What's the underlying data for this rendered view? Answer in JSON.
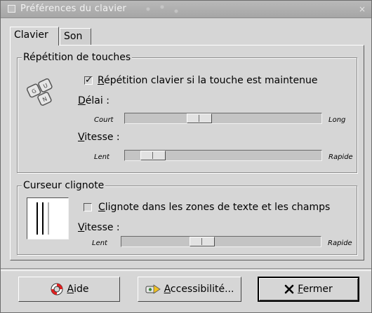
{
  "window": {
    "title": "Préférences du clavier",
    "close_glyph": "×"
  },
  "tabs": [
    {
      "label": "Clavier",
      "active": true
    },
    {
      "label": "Son",
      "active": false
    }
  ],
  "repeat_section": {
    "title": "Répétition de touches",
    "icon": "keyboard-icon",
    "checkbox": {
      "mnemonic": "R",
      "label_rest": "épétition clavier si la touche est maintenue",
      "checked": true,
      "check_glyph": "✓"
    },
    "delay": {
      "mnemonic": "D",
      "label_rest": "élai :",
      "min_label": "Court",
      "max_label": "Long",
      "value_fraction": 0.36
    },
    "speed": {
      "mnemonic": "V",
      "label_rest": "itesse :",
      "min_label": "Lent",
      "max_label": "Rapide",
      "value_fraction": 0.09
    }
  },
  "cursor_section": {
    "title": "Curseur clignote",
    "icon": "text-cursor-icon",
    "checkbox": {
      "mnemonic": "C",
      "label_rest": "lignote dans les zones de texte et les champs",
      "checked": false
    },
    "speed": {
      "mnemonic": "V",
      "label_rest": "itesse :",
      "min_label": "Lent",
      "max_label": "Rapide",
      "value_fraction": 0.39
    }
  },
  "buttons": {
    "help": {
      "mnemonic": "A",
      "rest": "ide",
      "icon": "lifebuoy-icon"
    },
    "accessibility": {
      "mnemonic": "A",
      "rest": "ccessibilité...",
      "icon": "accessibility-icon"
    },
    "close": {
      "mnemonic": "F",
      "rest": "ermer",
      "icon": "close-x-icon"
    }
  },
  "colors": {
    "window_bg": "#d6d6d6",
    "titlebar": "#b0b0b0",
    "lifebuoy_red": "#e02020",
    "accessibility_green": "#3c8a3c"
  }
}
